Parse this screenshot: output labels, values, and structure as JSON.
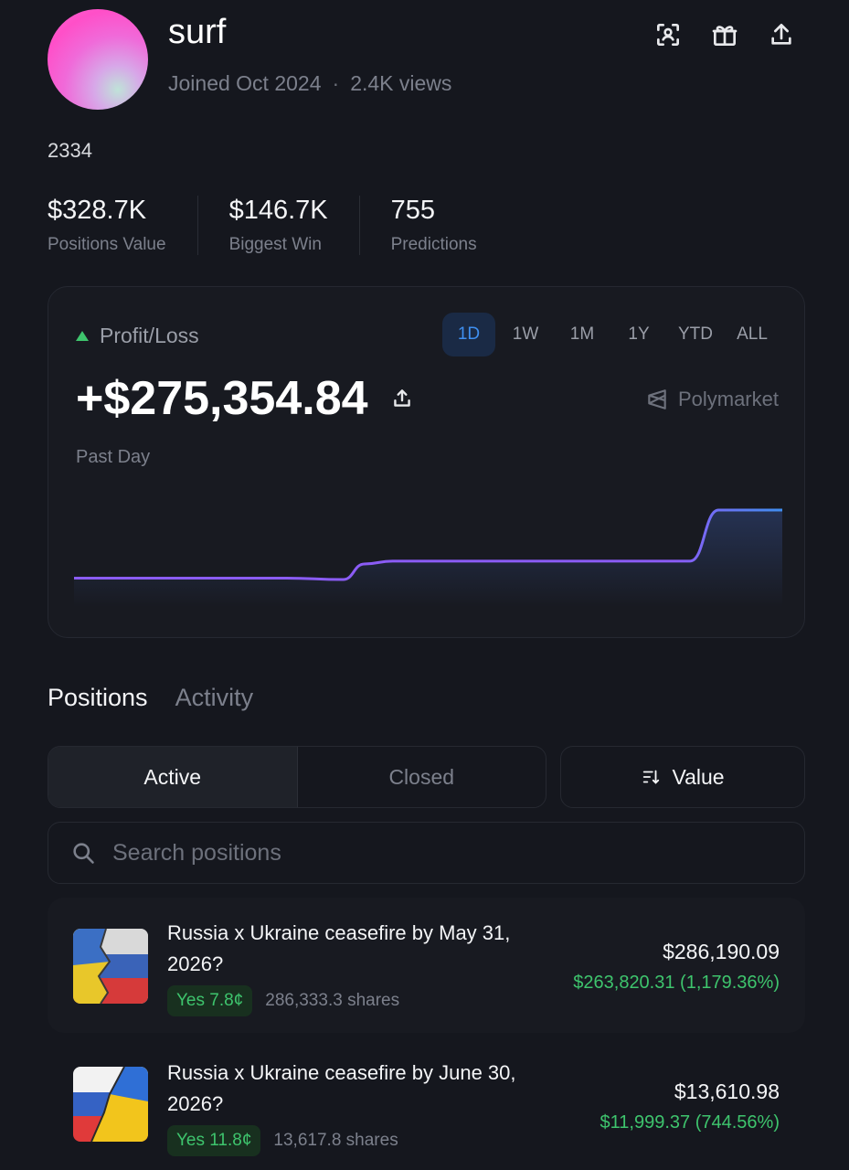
{
  "profile": {
    "username": "surf",
    "joined": "Joined Oct 2024",
    "separator": "·",
    "views": "2.4K views",
    "bio": "2334"
  },
  "header_icons": [
    "scan-icon",
    "gift-icon",
    "share-icon"
  ],
  "stats": [
    {
      "value": "$328.7K",
      "label": "Positions Value"
    },
    {
      "value": "$146.7K",
      "label": "Biggest Win"
    },
    {
      "value": "755",
      "label": "Predictions"
    }
  ],
  "pnl": {
    "title": "Profit/Loss",
    "ranges": [
      "1D",
      "1W",
      "1M",
      "1Y",
      "YTD",
      "ALL"
    ],
    "active_range": "1D",
    "value": "+$275,354.84",
    "period": "Past Day",
    "brand": "Polymarket",
    "colors": {
      "up": "#3ec46d",
      "line_start": "#8b5cf6",
      "line_end": "#3f8ff0"
    }
  },
  "chart_data": {
    "type": "line",
    "x": [
      0,
      0.1,
      0.2,
      0.3,
      0.38,
      0.41,
      0.45,
      0.5,
      0.6,
      0.7,
      0.8,
      0.87,
      0.91,
      0.95,
      1.0
    ],
    "values": [
      0,
      0,
      0,
      0,
      -1,
      10,
      12,
      12,
      12,
      12,
      12,
      12,
      48,
      48,
      48
    ],
    "title": "",
    "xlabel": "",
    "ylabel": ""
  },
  "tabs": [
    "Positions",
    "Activity"
  ],
  "filters": {
    "active": "Active",
    "closed": "Closed",
    "sort": "Value"
  },
  "search": {
    "placeholder": "Search positions",
    "value": ""
  },
  "positions": [
    {
      "title": "Russia x Ukraine ceasefire by May 31, 2026?",
      "badge": "Yes 7.8¢",
      "shares": "286,333.3 shares",
      "value": "$286,190.09",
      "gain": "$263,820.31 (1,179.36%)"
    },
    {
      "title": "Russia x Ukraine ceasefire by June 30, 2026?",
      "badge": "Yes 11.8¢",
      "shares": "13,617.8 shares",
      "value": "$13,610.98",
      "gain": "$11,999.37 (744.56%)"
    }
  ]
}
